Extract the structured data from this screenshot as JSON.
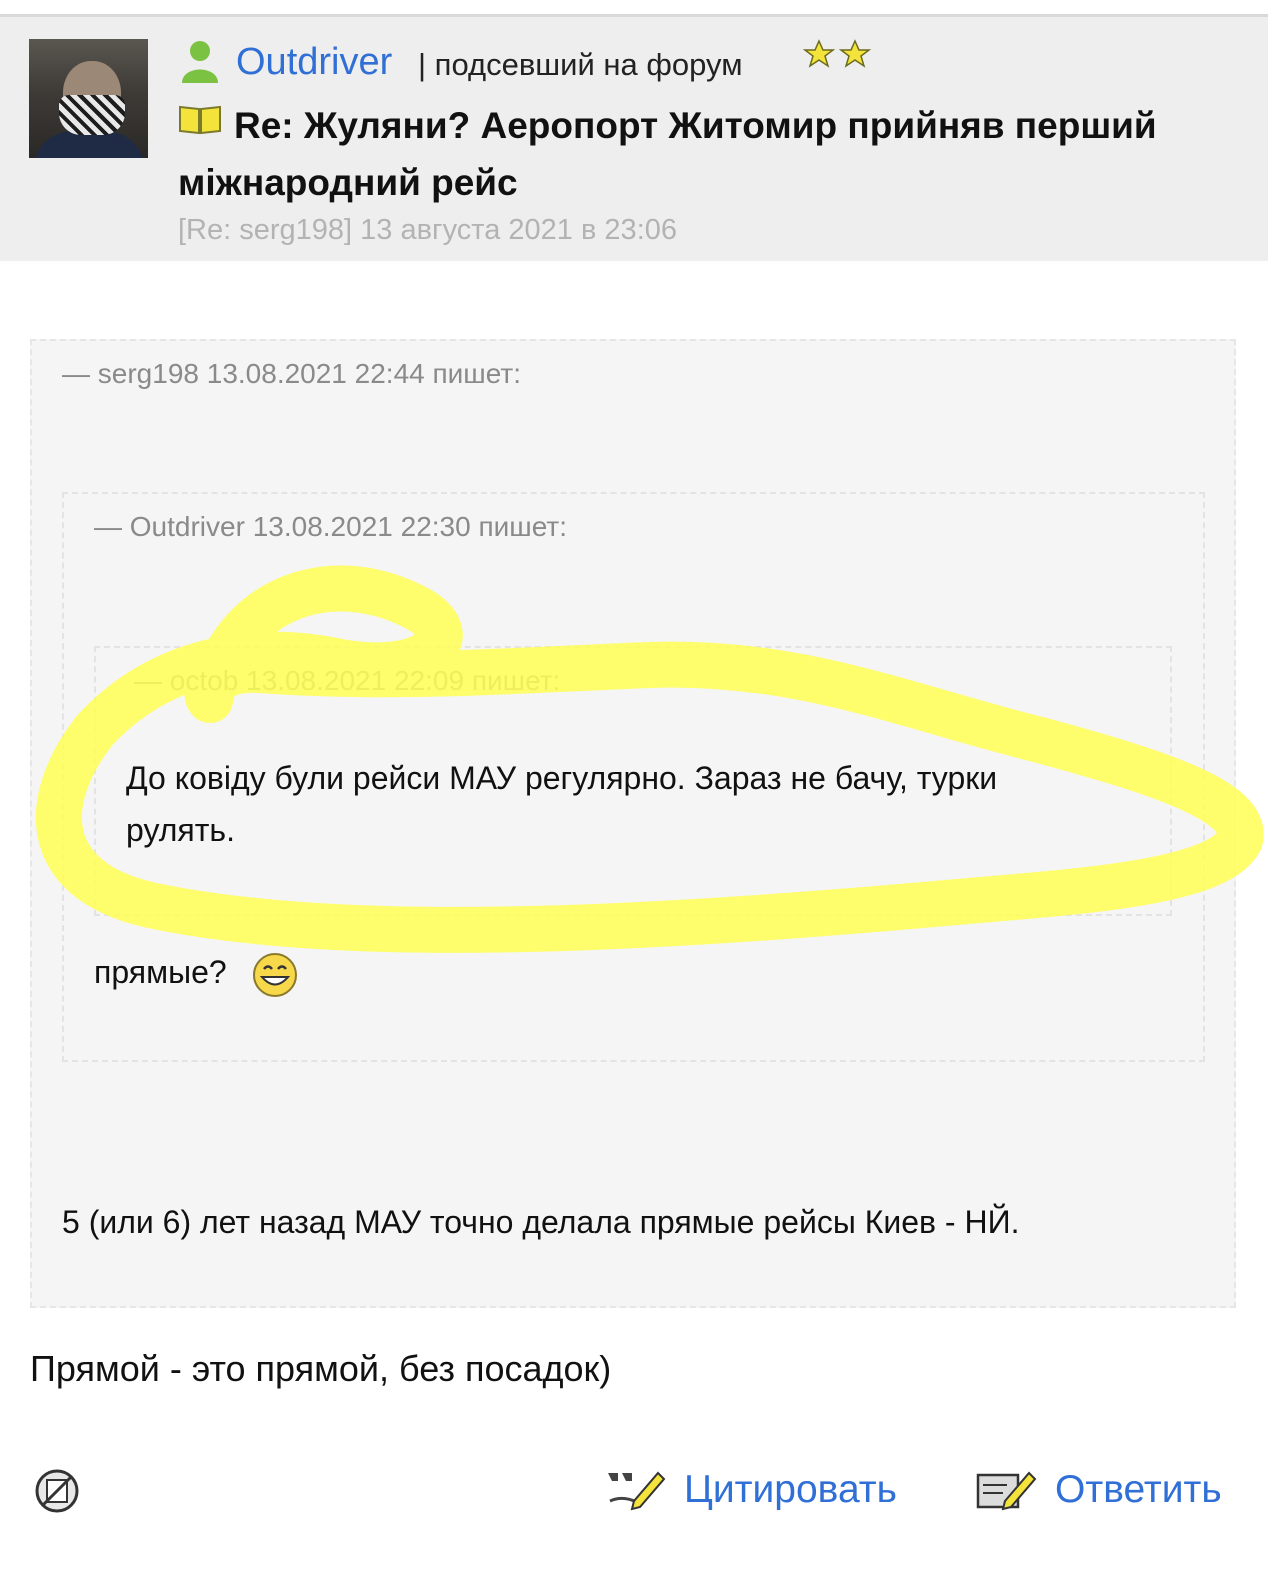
{
  "post": {
    "author": "Outdriver",
    "role": "| подсевший на форум",
    "title": "Re: Жуляни? Аеропорт Житомир прийняв перший міжнародний рейс",
    "meta": "[Re: serg198] 13 августа 2021 в 23:06",
    "reply_text": "Прямой - это прямой, без посадок)"
  },
  "quotes": {
    "outer": {
      "header": "— serg198 13.08.2021 22:44 пишет:",
      "text": "5 (или 6) лет назад МАУ точно делала прямые рейсы Киев - НЙ."
    },
    "middle": {
      "header": "— Outdriver 13.08.2021 22:30 пишет:",
      "text": "прямые?"
    },
    "inner": {
      "header": "— octob 13.08.2021 22:09 пишет:",
      "text": "До ковіду були рейси МАУ регулярно. Зараз не бачу, турки рулять."
    }
  },
  "actions": {
    "quote_label": "Цитировать",
    "reply_label": "Ответить"
  },
  "icons": {
    "user": "user-icon",
    "rank": "two-stars-icon",
    "post": "open-book-icon",
    "smiley": "grin-smiley-icon",
    "no_edit": "no-edit-icon",
    "quote": "quote-pen-icon",
    "reply": "reply-pen-icon"
  },
  "colors": {
    "link": "#2f6fd6",
    "header_bg": "#eeeeee",
    "quote_bg": "#f5f5f5",
    "highlight": "#ffff55"
  }
}
